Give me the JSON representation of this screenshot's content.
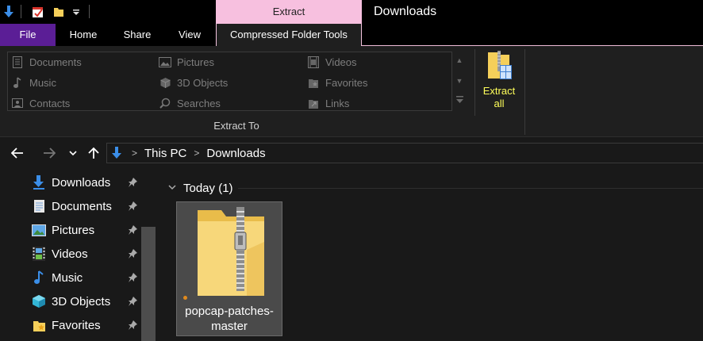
{
  "window": {
    "title": "Downloads",
    "context_tab_header": "Extract"
  },
  "quick_access": {
    "icons": [
      "downloads-arrow-icon",
      "properties-check-icon",
      "new-folder-icon",
      "customize-dropdown-icon"
    ]
  },
  "tabs": [
    {
      "label": "File"
    },
    {
      "label": "Home"
    },
    {
      "label": "Share"
    },
    {
      "label": "View"
    },
    {
      "label": "Compressed Folder Tools"
    }
  ],
  "ribbon": {
    "extract_to": {
      "items": [
        {
          "label": "Documents",
          "icon": "document-icon"
        },
        {
          "label": "Pictures",
          "icon": "pictures-icon"
        },
        {
          "label": "Videos",
          "icon": "videos-icon"
        },
        {
          "label": "Music",
          "icon": "music-icon"
        },
        {
          "label": "3D Objects",
          "icon": "3d-objects-icon"
        },
        {
          "label": "Favorites",
          "icon": "favorites-icon"
        },
        {
          "label": "Contacts",
          "icon": "contacts-icon"
        },
        {
          "label": "Searches",
          "icon": "searches-icon"
        },
        {
          "label": "Links",
          "icon": "links-icon"
        }
      ],
      "group_label": "Extract To"
    },
    "extract_all": {
      "line1": "Extract",
      "line2": "all"
    }
  },
  "address": {
    "segments": [
      "This PC",
      "Downloads"
    ],
    "separator": ">"
  },
  "sidebar": {
    "items": [
      {
        "label": "Downloads",
        "icon": "downloads-icon",
        "pinned": true
      },
      {
        "label": "Documents",
        "icon": "documents-icon",
        "pinned": true
      },
      {
        "label": "Pictures",
        "icon": "pictures-icon",
        "pinned": true
      },
      {
        "label": "Videos",
        "icon": "videos-icon",
        "pinned": true
      },
      {
        "label": "Music",
        "icon": "music-icon",
        "pinned": true
      },
      {
        "label": "3D Objects",
        "icon": "3d-objects-icon",
        "pinned": true
      },
      {
        "label": "Favorites",
        "icon": "favorites-icon",
        "pinned": true
      }
    ]
  },
  "content": {
    "group_header": "Today (1)",
    "files": [
      {
        "name_line1": "popcap-patches-",
        "name_line2": "master",
        "type": "compressed-folder"
      }
    ]
  },
  "colors": {
    "file_tab": "#5b1e96",
    "context_header": "#f7c0df",
    "extract_label": "#ffff5a",
    "selected_tile": "#4a4a4a",
    "background": "#191919"
  }
}
